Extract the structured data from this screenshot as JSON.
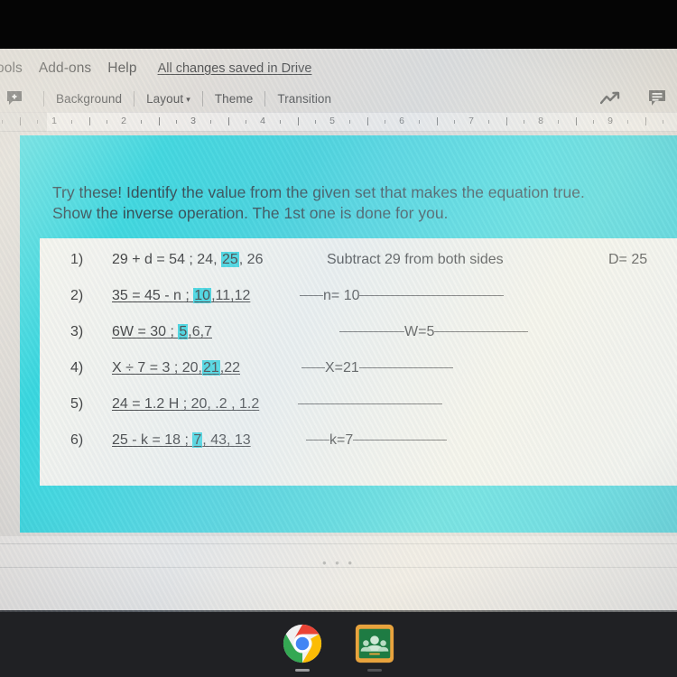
{
  "app": {
    "name": "Google Slides",
    "platform": "Chromebook"
  },
  "menubar": {
    "items": [
      {
        "label": "ools",
        "name": "menu-tools"
      },
      {
        "label": "Add-ons",
        "name": "menu-add-ons"
      },
      {
        "label": "Help",
        "name": "menu-help"
      }
    ],
    "save_status": "All changes saved in Drive"
  },
  "toolbar": {
    "left_icon": "add-comment-icon",
    "items": [
      {
        "label": "Background",
        "has_caret": false
      },
      {
        "label": "Layout",
        "has_caret": true
      },
      {
        "label": "Theme",
        "has_caret": false
      },
      {
        "label": "Transition",
        "has_caret": false
      }
    ],
    "caret_glyph": "▾",
    "right_icons": [
      {
        "name": "explore-trending-icon"
      },
      {
        "name": "comment-bubble-icon"
      }
    ]
  },
  "ruler": {
    "numbers": [
      "1",
      "2",
      "3",
      "4",
      "5",
      "6",
      "7",
      "8",
      "9"
    ]
  },
  "slide": {
    "background_color": "#2ad3dd",
    "highlight_color": "#2fd4de",
    "content_box_color": "#f2f3ee",
    "heading_line1": "Try these!  Identify the value from the given set that makes the equation true.",
    "heading_line2": "Show the inverse operation. The 1st one is done for you.",
    "questions": [
      {
        "number": "1)",
        "equation_prefix": "29 + d = 54  ;  24, ",
        "highlighted": "25",
        "equation_suffix": ", 26",
        "set_underlined": false,
        "work": "Subtract 29 from both sides",
        "answer": "D= 25"
      },
      {
        "number": "2)",
        "equation_prefix": "35 = 45 - n  ;  ",
        "highlighted": "10",
        "equation_suffix": ",11,12",
        "set_underlined": true,
        "work": "n= 10",
        "answer": ""
      },
      {
        "number": "3)",
        "equation_prefix": "6W = 30  ;  ",
        "highlighted": "5",
        "equation_suffix": ",6,7",
        "set_underlined": true,
        "work": "W=5",
        "answer": ""
      },
      {
        "number": "4)",
        "equation_prefix": "X ÷ 7 = 3  ; 20,",
        "highlighted": "21",
        "equation_suffix": ",22",
        "set_underlined": true,
        "work": "X=21",
        "answer": ""
      },
      {
        "number": "5)",
        "equation_prefix": "24 = 1.2 H ; 20, .2 , 1.2",
        "highlighted": "",
        "equation_suffix": "",
        "set_underlined": true,
        "work": "",
        "answer": ""
      },
      {
        "number": "6)",
        "equation_prefix": "25 - k = 18 ; ",
        "highlighted": "7",
        "equation_suffix": ", 43, 13",
        "set_underlined": true,
        "work": "k=7",
        "answer": ""
      }
    ]
  },
  "filmstrip": {
    "drag_handle": "• • •"
  },
  "shelf": {
    "apps": [
      {
        "name": "chrome-icon",
        "label": "Chrome",
        "running": true
      },
      {
        "name": "google-classroom-icon",
        "label": "Classroom",
        "running": true
      }
    ]
  }
}
